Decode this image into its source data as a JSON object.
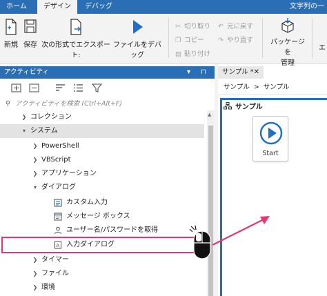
{
  "tabs": [
    {
      "label": "ホーム"
    },
    {
      "label": "デザイン"
    },
    {
      "label": "デバッグ"
    }
  ],
  "title_right": "文字列の一",
  "ribbon": {
    "new_label": "新規",
    "save_label": "保存",
    "export_label": "次の形式でエクスポート:",
    "debug_label": "ファイルをデバッグ",
    "cut_label": "切り取り",
    "copy_label": "コピー",
    "paste_label": "貼り付け",
    "undo_label": "元に戻す",
    "redo_label": "やり直す",
    "package_label_1": "パッケージを",
    "package_label_2": "管理",
    "more_label": "エ"
  },
  "activities_panel": {
    "title": "アクティビティ",
    "controls": "▾ ⊓",
    "search_placeholder": "アクティビティを検索 (Ctrl+Alt+F)"
  },
  "tree": [
    {
      "label": "コレクション",
      "state": "collapsed"
    },
    {
      "label": "システム",
      "state": "expanded"
    },
    {
      "label": "PowerShell",
      "state": "collapsed"
    },
    {
      "label": "VBScript",
      "state": "collapsed"
    },
    {
      "label": "アプリケーション",
      "state": "collapsed"
    },
    {
      "label": "ダイアログ",
      "state": "expanded"
    },
    {
      "label": "カスタム入力",
      "state": "leaf"
    },
    {
      "label": "メッセージ ボックス",
      "state": "leaf"
    },
    {
      "label": "ユーザー名/パスワードを取得",
      "state": "leaf"
    },
    {
      "label": "入力ダイアログ",
      "state": "leaf"
    },
    {
      "label": "タイマー",
      "state": "collapsed"
    },
    {
      "label": "ファイル",
      "state": "collapsed"
    },
    {
      "label": "環境",
      "state": "collapsed"
    }
  ],
  "designer": {
    "tab_label": "サンプル *",
    "breadcrumb_1": "サンプル",
    "breadcrumb_sep": ">",
    "breadcrumb_2": "サンプル",
    "sequence_title": "サンプル",
    "start_label": "Start"
  },
  "colors": {
    "accent": "#2a6fb6",
    "highlight": "#e8346f",
    "sequence_border": "#1f6fc5"
  }
}
